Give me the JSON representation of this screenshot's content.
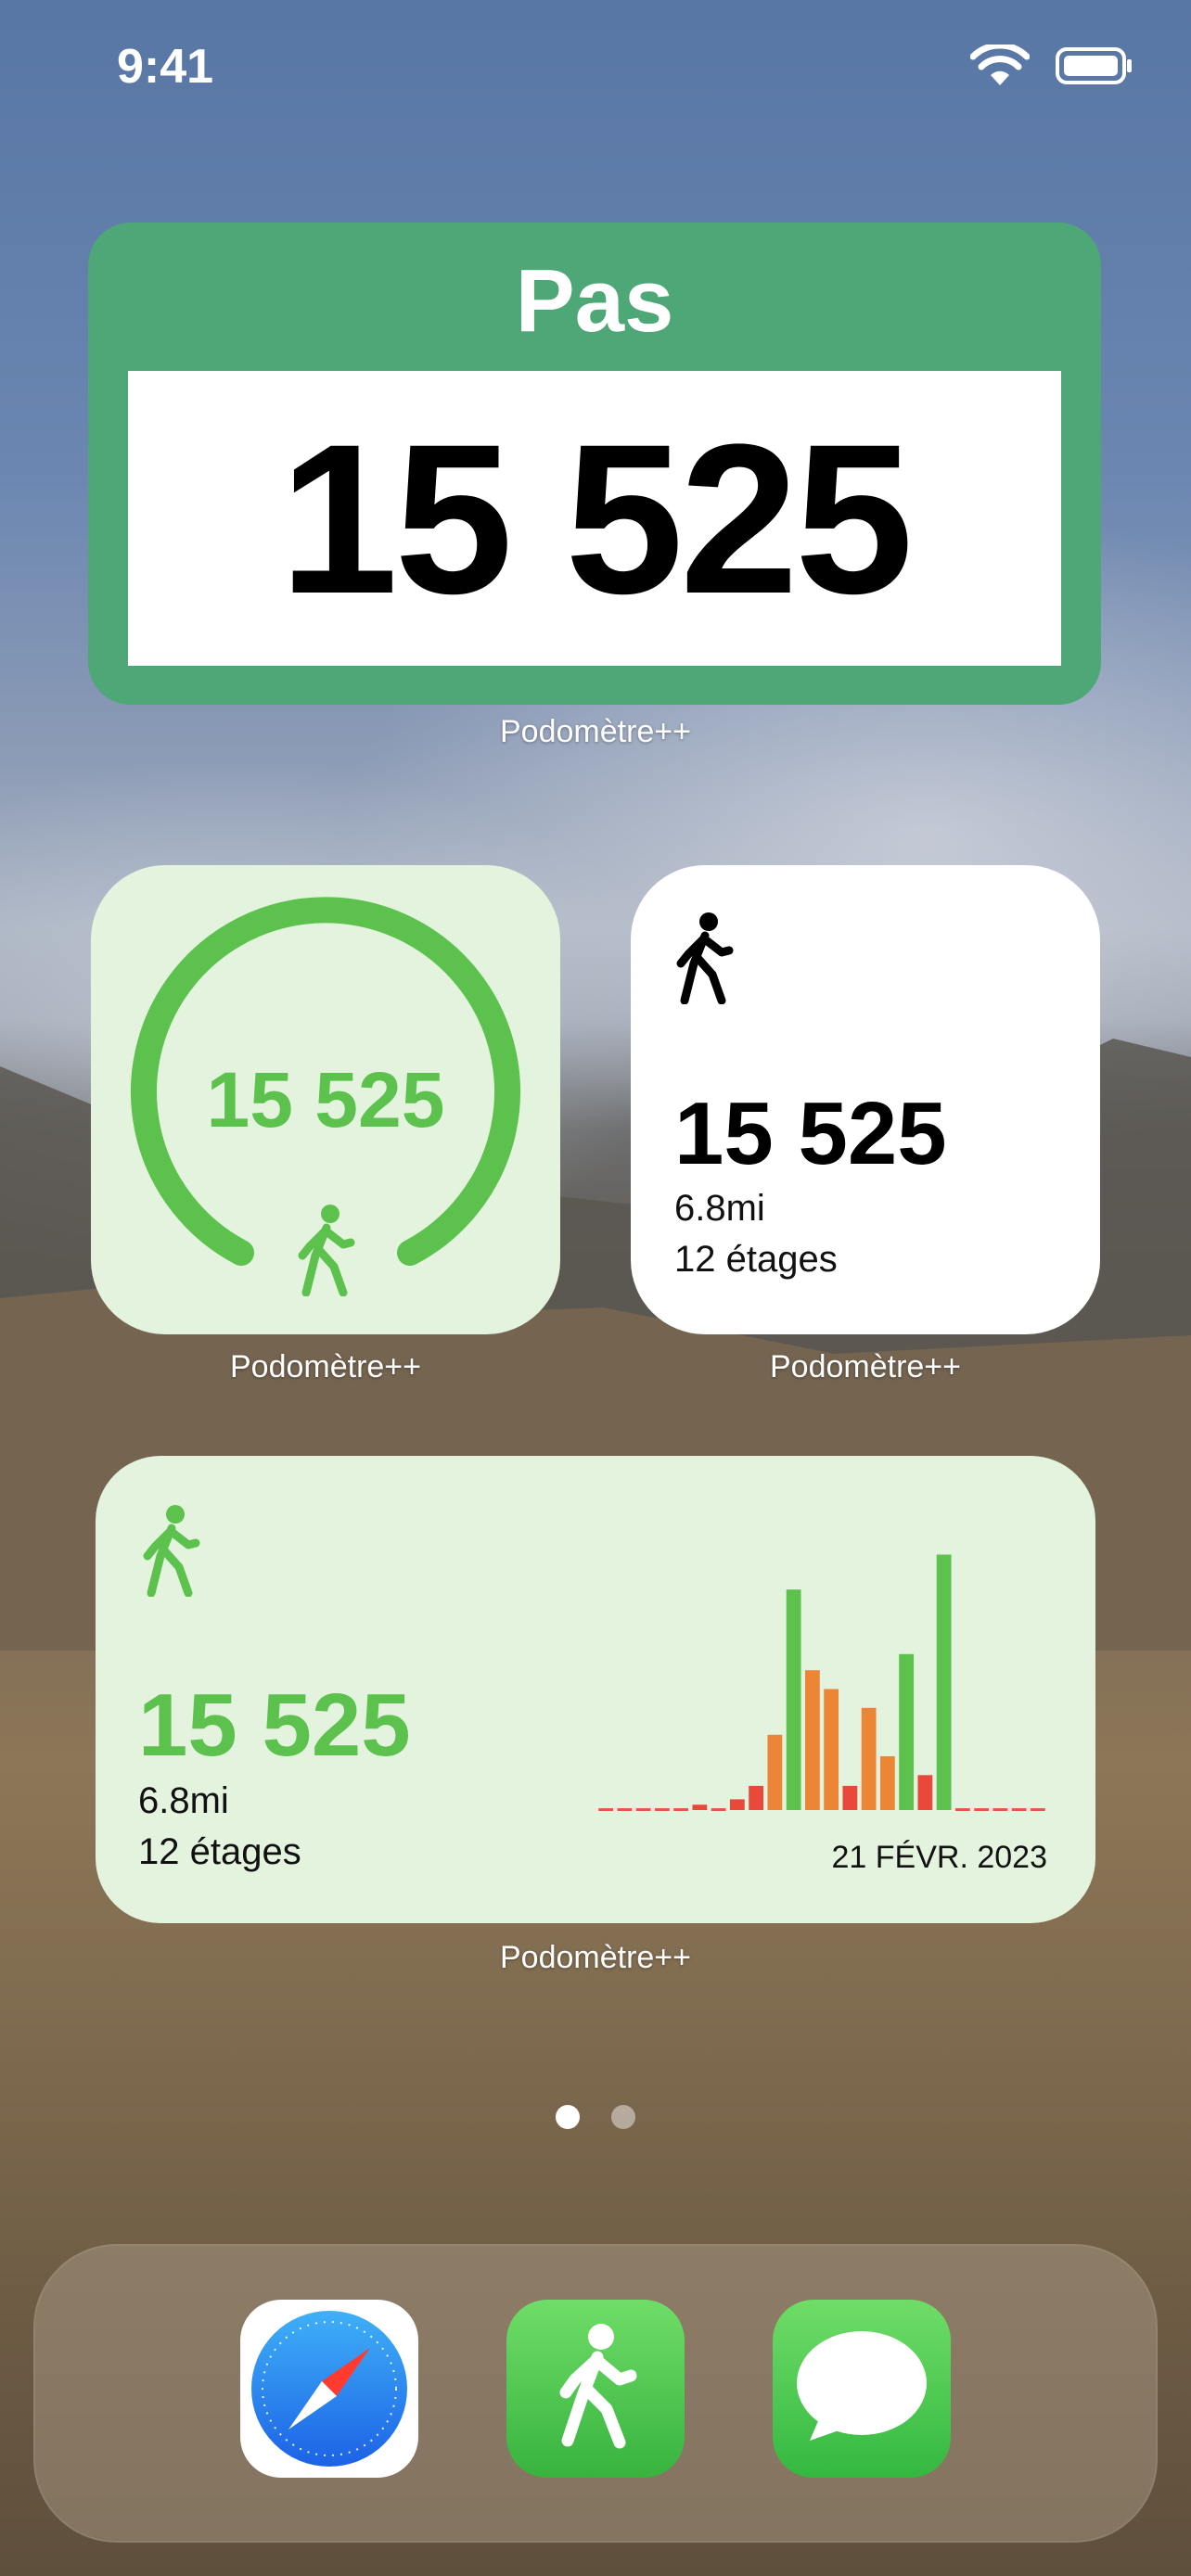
{
  "status_bar": {
    "time": "9:41"
  },
  "widgets": {
    "large": {
      "title": "Pas",
      "steps": "15 525",
      "caption": "Podomètre++"
    },
    "ring": {
      "steps": "15 525",
      "caption": "Podomètre++"
    },
    "stat": {
      "steps": "15 525",
      "distance": "6.8mi",
      "floors": "12 étages",
      "caption": "Podomètre++"
    },
    "medium": {
      "steps": "15 525",
      "distance": "6.8mi",
      "floors": "12 étages",
      "date": "21 FÉVR. 2023",
      "caption": "Podomètre++"
    }
  },
  "colors": {
    "large_widget_bg": "#4ea776",
    "accent_green": "#5cc14d",
    "widget_light_green": "#e3f3de",
    "bar_orange": "#ed8536",
    "bar_red": "#e8493b"
  },
  "chart_data": {
    "type": "bar",
    "title": "",
    "xlabel": "",
    "ylabel": "",
    "note": "hourly steps for the day, 24 bars, colored by intensity",
    "values": [
      0,
      0,
      0,
      0,
      0,
      0.02,
      0,
      0.04,
      0.09,
      0.28,
      0.82,
      0.52,
      0.45,
      0.09,
      0.38,
      0.2,
      0.58,
      0.13,
      0.95,
      0,
      0,
      0,
      0,
      0
    ],
    "colors": [
      "none",
      "none",
      "none",
      "none",
      "none",
      "red",
      "none",
      "red",
      "red",
      "orange",
      "green",
      "orange",
      "orange",
      "red",
      "orange",
      "orange",
      "green",
      "red",
      "green",
      "none",
      "none",
      "none",
      "none",
      "none"
    ]
  },
  "pagination": {
    "total": 2,
    "active": 0
  },
  "dock": {
    "apps": [
      {
        "name": "Safari",
        "icon": "compass-icon"
      },
      {
        "name": "Podomètre++",
        "icon": "walking-person-icon"
      },
      {
        "name": "Messages",
        "icon": "speech-bubble-icon"
      }
    ]
  }
}
